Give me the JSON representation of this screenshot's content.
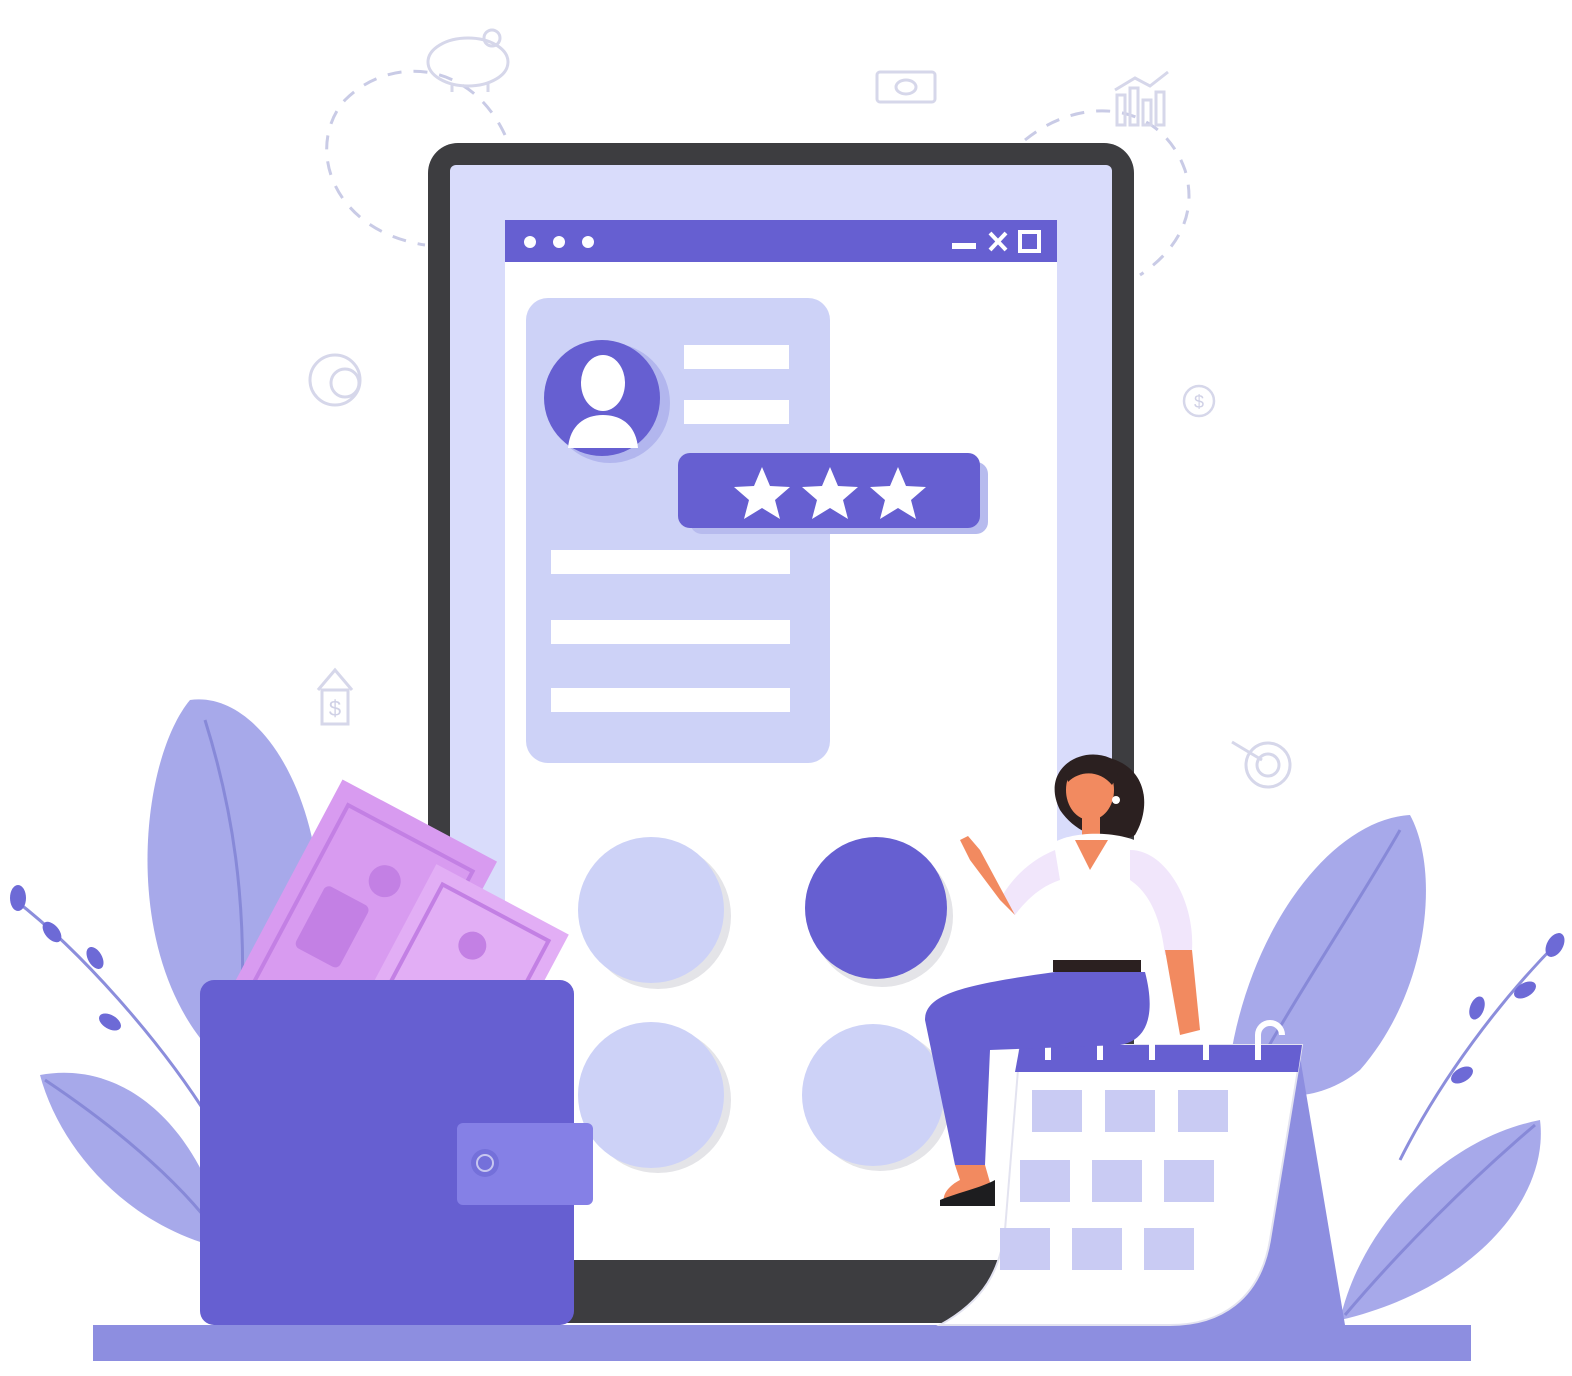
{
  "illustration": {
    "subject": "profile-rating-illustration",
    "rating": {
      "stars_filled": 3,
      "stars_total": 3
    }
  },
  "window": {
    "dots": 3,
    "controls": [
      "minimize-icon",
      "close-icon",
      "maximize-icon"
    ]
  },
  "icons": [
    "piggy-bank-icon",
    "banknote-icon",
    "bar-chart-icon",
    "coin-icon",
    "dollar-icon",
    "dollar-arrow-icon",
    "target-icon"
  ],
  "colors": {
    "accent": "#665fd1",
    "accent_light": "#c9cef5",
    "screen_bg": "#d9dcfb",
    "card_bg": "#c9cef5",
    "device_frame": "#3d3d40",
    "leaf": "#a7a9ea",
    "money": "#d89bf0",
    "ground": "#8d8ee0",
    "line": "#dcdcec"
  }
}
